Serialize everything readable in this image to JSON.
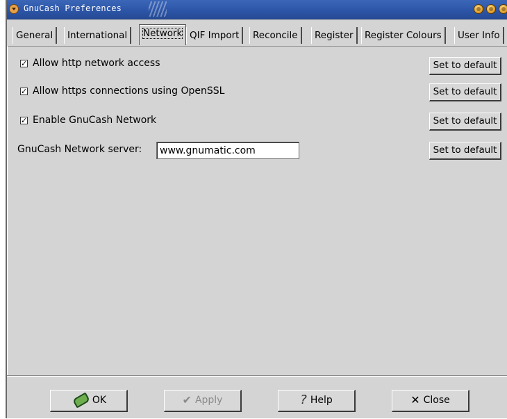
{
  "window": {
    "title": "GnuCash Preferences"
  },
  "tabs": [
    {
      "label": "General"
    },
    {
      "label": "International"
    },
    {
      "label": "Network"
    },
    {
      "label": "QIF Import"
    },
    {
      "label": "Reconcile"
    },
    {
      "label": "Register"
    },
    {
      "label": "Register Colours"
    },
    {
      "label": "User Info"
    }
  ],
  "active_tab": "Network",
  "options": [
    {
      "label": "Allow http network access",
      "checked": true,
      "check_glyph": "✓"
    },
    {
      "label": "Allow https connections using OpenSSL",
      "checked": true,
      "check_glyph": "✓"
    },
    {
      "label": "Enable GnuCash Network",
      "checked": true,
      "check_glyph": "✓"
    }
  ],
  "server": {
    "label": "GnuCash Network server:",
    "value": "www.gnumatic.com"
  },
  "default_button_label": "Set to default",
  "buttons": {
    "ok": "OK",
    "apply": "Apply",
    "help": "Help",
    "close": "Close"
  },
  "icons": {
    "ok": "hand-ok-icon",
    "apply": "checkmark-icon",
    "help": "question-icon",
    "close": "x-close-icon"
  }
}
